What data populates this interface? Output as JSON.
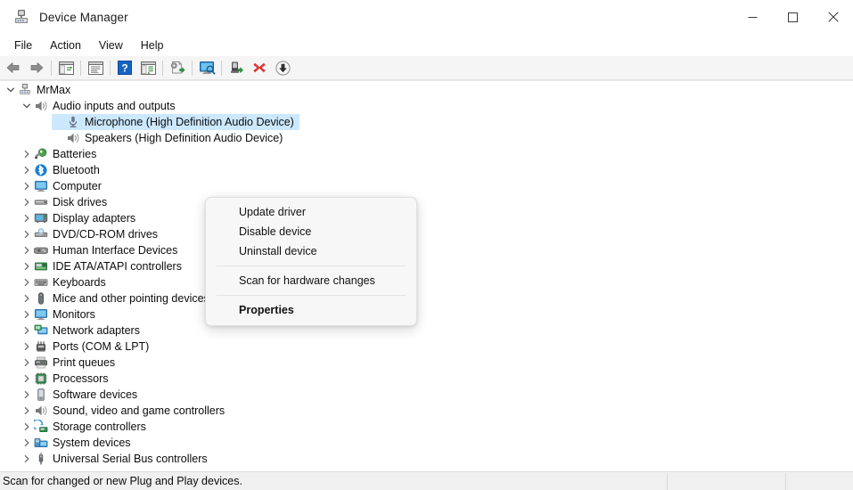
{
  "window": {
    "title": "Device Manager",
    "icon": "device-manager-icon",
    "caption_buttons": [
      {
        "name": "minimize-button",
        "glyph": "minimize"
      },
      {
        "name": "maximize-button",
        "glyph": "maximize"
      },
      {
        "name": "close-button",
        "glyph": "close"
      }
    ]
  },
  "menubar": {
    "items": [
      {
        "label": "File",
        "name": "menu-file"
      },
      {
        "label": "Action",
        "name": "menu-action"
      },
      {
        "label": "View",
        "name": "menu-view"
      },
      {
        "label": "Help",
        "name": "menu-help"
      }
    ]
  },
  "toolbar": {
    "buttons": [
      {
        "name": "back-button",
        "icon": "back-arrow-icon"
      },
      {
        "name": "forward-button",
        "icon": "forward-arrow-icon"
      },
      {
        "name": "separator-1",
        "icon": "separator"
      },
      {
        "name": "show-hide-console-tree-button",
        "icon": "console-tree-icon"
      },
      {
        "name": "separator-2",
        "icon": "separator"
      },
      {
        "name": "properties-button",
        "icon": "properties-icon"
      },
      {
        "name": "separator-3",
        "icon": "separator"
      },
      {
        "name": "help-button",
        "icon": "help-question-icon"
      },
      {
        "name": "show-hide-action-pane-button",
        "icon": "action-pane-icon"
      },
      {
        "name": "separator-4",
        "icon": "separator"
      },
      {
        "name": "update-driver-button",
        "icon": "update-driver-icon"
      },
      {
        "name": "separator-5",
        "icon": "separator"
      },
      {
        "name": "scan-hardware-changes-button",
        "icon": "scan-monitor-icon"
      },
      {
        "name": "separator-6",
        "icon": "separator"
      },
      {
        "name": "enable-device-button",
        "icon": "enable-device-icon"
      },
      {
        "name": "uninstall-device-button",
        "icon": "uninstall-red-x-icon"
      },
      {
        "name": "disable-device-button",
        "icon": "disable-down-arrow-icon"
      }
    ]
  },
  "tree": {
    "nodes": [
      {
        "label": "MrMax",
        "depth": 0,
        "state": "expanded",
        "icon": "computer-node-icon",
        "selected": false
      },
      {
        "label": "Audio inputs and outputs",
        "depth": 1,
        "state": "expanded",
        "icon": "speaker-icon",
        "selected": false
      },
      {
        "label": "Microphone (High Definition Audio Device)",
        "depth": 2,
        "state": "leaf",
        "icon": "microphone-icon",
        "selected": true
      },
      {
        "label": "Speakers (High Definition Audio Device)",
        "depth": 2,
        "state": "leaf",
        "icon": "speaker-icon",
        "selected": false
      },
      {
        "label": "Batteries",
        "depth": 1,
        "state": "collapsed",
        "icon": "battery-icon",
        "selected": false
      },
      {
        "label": "Bluetooth",
        "depth": 1,
        "state": "collapsed",
        "icon": "bluetooth-icon",
        "selected": false
      },
      {
        "label": "Computer",
        "depth": 1,
        "state": "collapsed",
        "icon": "monitor-icon",
        "selected": false
      },
      {
        "label": "Disk drives",
        "depth": 1,
        "state": "collapsed",
        "icon": "disk-drive-icon",
        "selected": false
      },
      {
        "label": "Display adapters",
        "depth": 1,
        "state": "collapsed",
        "icon": "display-adapter-icon",
        "selected": false
      },
      {
        "label": "DVD/CD-ROM drives",
        "depth": 1,
        "state": "collapsed",
        "icon": "dvd-drive-icon",
        "selected": false
      },
      {
        "label": "Human Interface Devices",
        "depth": 1,
        "state": "collapsed",
        "icon": "hid-gamepad-icon",
        "selected": false
      },
      {
        "label": "IDE ATA/ATAPI controllers",
        "depth": 1,
        "state": "collapsed",
        "icon": "ide-controller-icon",
        "selected": false
      },
      {
        "label": "Keyboards",
        "depth": 1,
        "state": "collapsed",
        "icon": "keyboard-icon",
        "selected": false
      },
      {
        "label": "Mice and other pointing devices",
        "depth": 1,
        "state": "collapsed",
        "icon": "mouse-icon",
        "selected": false
      },
      {
        "label": "Monitors",
        "depth": 1,
        "state": "collapsed",
        "icon": "monitor-icon",
        "selected": false
      },
      {
        "label": "Network adapters",
        "depth": 1,
        "state": "collapsed",
        "icon": "network-adapter-icon",
        "selected": false
      },
      {
        "label": "Ports (COM & LPT)",
        "depth": 1,
        "state": "collapsed",
        "icon": "port-icon",
        "selected": false
      },
      {
        "label": "Print queues",
        "depth": 1,
        "state": "collapsed",
        "icon": "printer-icon",
        "selected": false
      },
      {
        "label": "Processors",
        "depth": 1,
        "state": "collapsed",
        "icon": "processor-icon",
        "selected": false
      },
      {
        "label": "Software devices",
        "depth": 1,
        "state": "collapsed",
        "icon": "software-device-icon",
        "selected": false
      },
      {
        "label": "Sound, video and game controllers",
        "depth": 1,
        "state": "collapsed",
        "icon": "speaker-icon",
        "selected": false
      },
      {
        "label": "Storage controllers",
        "depth": 1,
        "state": "collapsed",
        "icon": "storage-controller-icon",
        "selected": false
      },
      {
        "label": "System devices",
        "depth": 1,
        "state": "collapsed",
        "icon": "system-device-icon",
        "selected": false
      },
      {
        "label": "Universal Serial Bus controllers",
        "depth": 1,
        "state": "collapsed",
        "icon": "usb-icon",
        "selected": false
      }
    ]
  },
  "context_menu": {
    "visible": true,
    "items": [
      {
        "type": "item",
        "label": "Update driver",
        "name": "ctx-update-driver",
        "bold": false
      },
      {
        "type": "item",
        "label": "Disable device",
        "name": "ctx-disable-device",
        "bold": false
      },
      {
        "type": "item",
        "label": "Uninstall device",
        "name": "ctx-uninstall-device",
        "bold": false
      },
      {
        "type": "separator"
      },
      {
        "type": "item",
        "label": "Scan for hardware changes",
        "name": "ctx-scan-hardware-changes",
        "bold": false
      },
      {
        "type": "separator"
      },
      {
        "type": "item",
        "label": "Properties",
        "name": "ctx-properties",
        "bold": true
      }
    ]
  },
  "statusbar": {
    "message": "Scan for changed or new Plug and Play devices.",
    "panel2": "",
    "panel3": ""
  },
  "colors": {
    "selection": "#cce8ff",
    "toolbar_bg": "#f5f5f5",
    "statusbar_bg": "#f0f0f0",
    "menu_bg": "#f7f7f7",
    "text": "#0c0c0c"
  }
}
